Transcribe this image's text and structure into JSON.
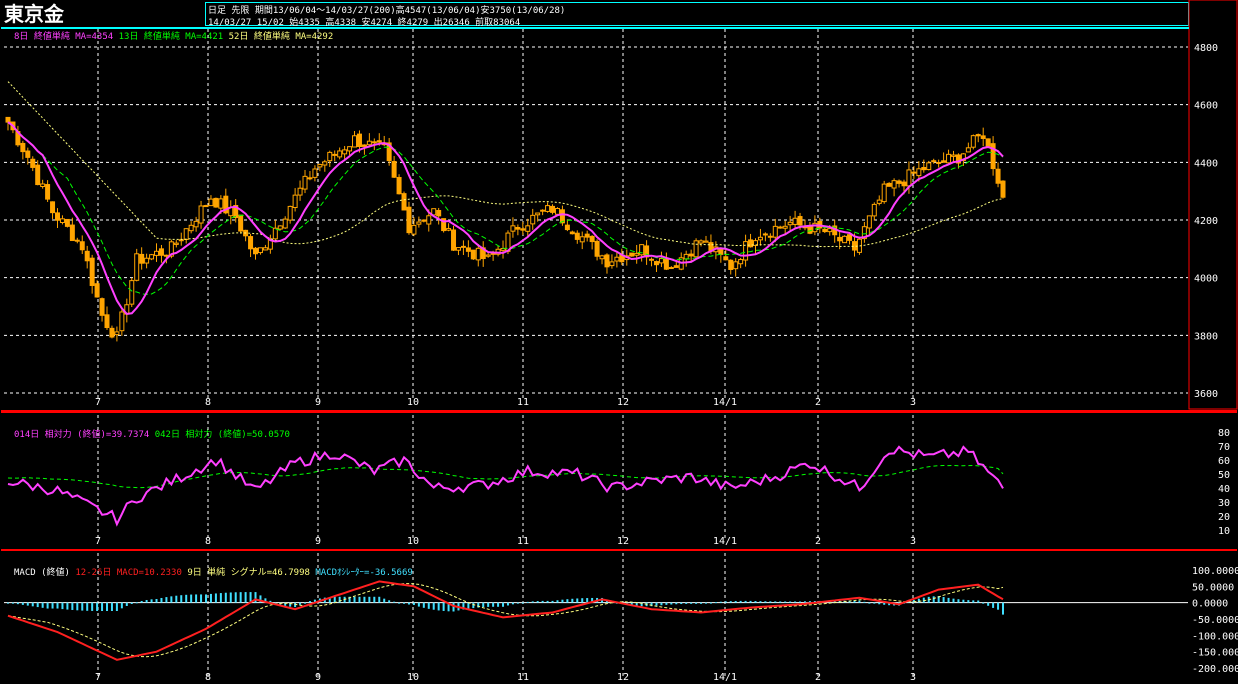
{
  "app": {
    "title": "東京金",
    "info_line1": "日足 先限 期間13/06/04～14/03/27(200)高4547(13/06/04)安3750(13/06/28)",
    "info_line2": "14/03/27 15/02 始4335 高4338 安4274 終4279 出26346 前取83064"
  },
  "colors": {
    "background": "#000000",
    "candle": "#ffa500",
    "ma8": "#ff40ff",
    "ma13": "#00ff00",
    "ma52": "#ffff80",
    "rsi14": "#ff40ff",
    "rsi42": "#00ff00",
    "macd_line": "#ff2020",
    "signal": "#ffff80",
    "histogram": "#40e0ff",
    "grid": "#ffffff",
    "frame": "#ff0000"
  },
  "panels": {
    "price": {
      "legend": [
        {
          "text": "8日 終値単純 MA=4354",
          "color": "#ff40ff"
        },
        {
          "text": "13日 終値単純 MA=4421",
          "color": "#00ff00"
        },
        {
          "text": "52日 終値単純 MA=4292",
          "color": "#ffff80"
        }
      ],
      "y_ticks": [
        "4800",
        "4600",
        "4400",
        "4200",
        "4000",
        "3800",
        "3600"
      ]
    },
    "rsi": {
      "legend": [
        {
          "text": "014日 相対力 (終値)=39.7374",
          "color": "#ff40ff"
        },
        {
          "text": "042日 相対力 (終値)=50.0570",
          "color": "#00ff00"
        }
      ],
      "y_ticks": [
        "80",
        "70",
        "60",
        "50",
        "40",
        "30",
        "20",
        "10"
      ]
    },
    "macd": {
      "legend": [
        {
          "text": "MACD (終値)",
          "color": "#ffffff"
        },
        {
          "text": "12-26日 MACD=10.2330",
          "color": "#ff2020"
        },
        {
          "text": "9日 単純 シグナル=46.7998",
          "color": "#ffff80"
        },
        {
          "text": "MACDｵｼﾚｰﾀｰ=-36.5669",
          "color": "#40e0ff"
        }
      ],
      "y_ticks": [
        "100.0000",
        "50.0000",
        "0.0000",
        "-50.0000",
        "-100.0000",
        "-150.0000",
        "-200.0000"
      ]
    }
  },
  "x_labels": [
    "7",
    "8",
    "9",
    "10",
    "11",
    "12",
    "14/1",
    "2",
    "3"
  ],
  "chart_data": [
    {
      "type": "candlestick",
      "title": "東京金",
      "ylim": [
        3600,
        4850
      ],
      "x_ticks": [
        "7",
        "8",
        "9",
        "10",
        "11",
        "12",
        "14/1",
        "2",
        "3"
      ],
      "close_waypoints": [
        [
          0,
          4540
        ],
        [
          4,
          4420
        ],
        [
          9,
          4230
        ],
        [
          15,
          4110
        ],
        [
          19,
          3870
        ],
        [
          22,
          3790
        ],
        [
          26,
          4060
        ],
        [
          33,
          4100
        ],
        [
          41,
          4280
        ],
        [
          46,
          4210
        ],
        [
          50,
          4070
        ],
        [
          55,
          4200
        ],
        [
          62,
          4380
        ],
        [
          70,
          4480
        ],
        [
          76,
          4440
        ],
        [
          81,
          4180
        ],
        [
          86,
          4230
        ],
        [
          90,
          4120
        ],
        [
          97,
          4060
        ],
        [
          103,
          4180
        ],
        [
          110,
          4240
        ],
        [
          116,
          4140
        ],
        [
          121,
          4060
        ],
        [
          128,
          4100
        ],
        [
          134,
          4040
        ],
        [
          140,
          4130
        ],
        [
          146,
          4040
        ],
        [
          151,
          4150
        ],
        [
          158,
          4190
        ],
        [
          165,
          4160
        ],
        [
          171,
          4100
        ],
        [
          177,
          4300
        ],
        [
          185,
          4380
        ],
        [
          192,
          4420
        ],
        [
          197,
          4500
        ],
        [
          201,
          4290
        ]
      ],
      "series": [
        {
          "name": "8日 終値単純 MA",
          "last": 4354
        },
        {
          "name": "13日 終値単純 MA",
          "last": 4421
        },
        {
          "name": "52日 終値単純 MA",
          "last": 4292
        }
      ],
      "last_bar": {
        "open": 4335,
        "high": 4338,
        "low": 4274,
        "close": 4279
      }
    },
    {
      "type": "line",
      "ylim": [
        10,
        80
      ],
      "series": [
        {
          "name": "014日 相対力 (終値)",
          "last": 39.7374
        },
        {
          "name": "042日 相対力 (終値)",
          "last": 50.057
        }
      ]
    },
    {
      "type": "line",
      "ylim": [
        -200,
        100
      ],
      "series": [
        {
          "name": "12-26日 MACD",
          "last": 10.233
        },
        {
          "name": "9日 単純 シグナル",
          "last": 46.7998
        },
        {
          "name": "MACDｵｼﾚｰﾀｰ",
          "last": -36.5669
        }
      ]
    }
  ]
}
